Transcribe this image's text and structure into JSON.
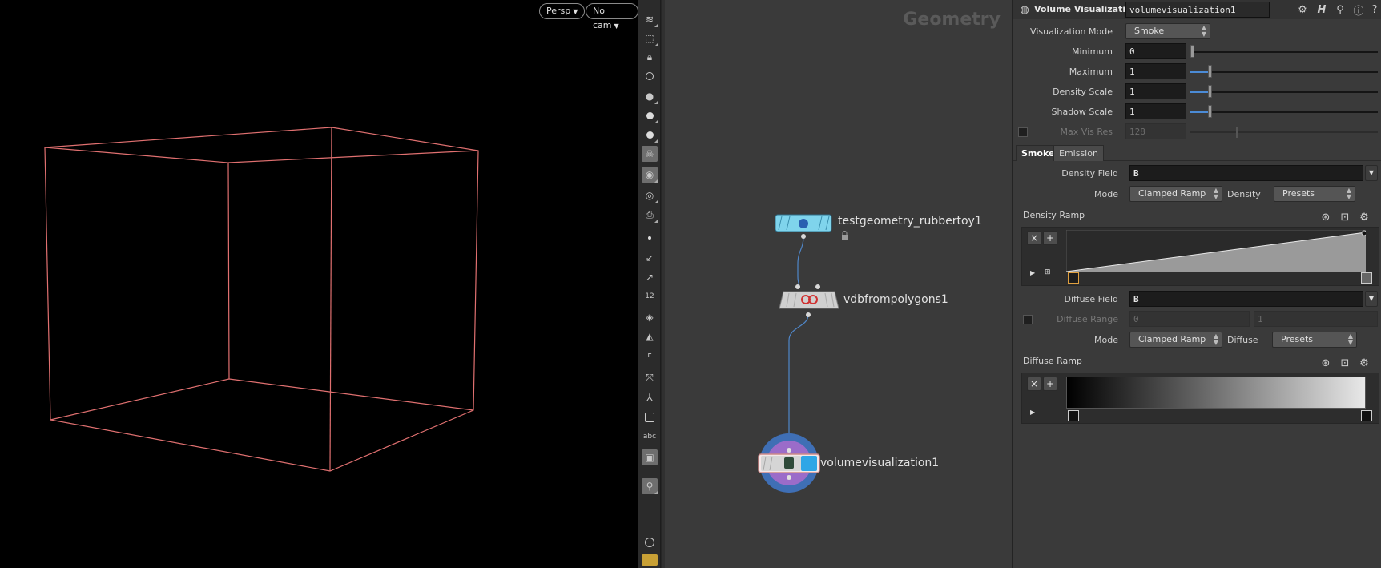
{
  "viewport": {
    "camera_menu": "Persp",
    "no_cam_menu": "No cam"
  },
  "network": {
    "title": "Geometry",
    "nodes": [
      {
        "name": "testgeometry_rubbertoy1"
      },
      {
        "name": "vdbfrompolygons1"
      },
      {
        "name": "volumevisualization1"
      }
    ]
  },
  "params": {
    "node_type": "Volume Visualization",
    "node_name": "volumevisualization1",
    "visualization_mode_label": "Visualization Mode",
    "visualization_mode_value": "Smoke",
    "minimum_label": "Minimum",
    "minimum_value": "0",
    "maximum_label": "Maximum",
    "maximum_value": "1",
    "density_scale_label": "Density Scale",
    "density_scale_value": "1",
    "shadow_scale_label": "Shadow Scale",
    "shadow_scale_value": "1",
    "max_vis_res_label": "Max Vis Res",
    "max_vis_res_value": "128",
    "tabs": [
      "Smoke",
      "Emission"
    ],
    "density_field_label": "Density Field",
    "density_field_value": "B",
    "density_mode_label": "Mode",
    "density_mode_value": "Clamped Ramp",
    "density_preset_label": "Density",
    "density_preset_value": "Presets",
    "density_ramp_label": "Density Ramp",
    "diffuse_field_label": "Diffuse Field",
    "diffuse_field_value": "B",
    "diffuse_range_label": "Diffuse Range",
    "diffuse_range_min": "0",
    "diffuse_range_max": "1",
    "diffuse_mode_label": "Mode",
    "diffuse_mode_value": "Clamped Ramp",
    "diffuse_preset_label": "Diffuse",
    "diffuse_preset_value": "Presets",
    "diffuse_ramp_label": "Diffuse Ramp"
  },
  "shelf": {
    "text_tool_label": "abc",
    "snap_label": "12"
  },
  "colors": {
    "bbox_wire": "#e07070",
    "slider_fill": "#4b8bd6",
    "node_display_ring": "#3f6fb5",
    "node_render_ring": "#9b6cc9"
  }
}
